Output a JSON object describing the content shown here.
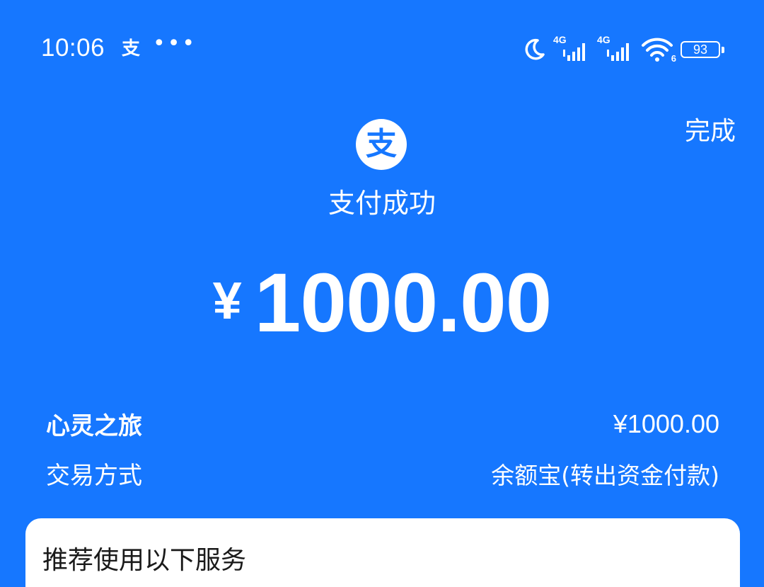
{
  "status_bar": {
    "time": "10:06",
    "app_icon_glyph": "支",
    "more_glyph": "•••",
    "net_label_1": "4G",
    "net_label_2": "4G",
    "wifi_sub": "6",
    "battery": "93",
    "icons": [
      "moon-icon",
      "signal-icon",
      "signal-icon",
      "wifi-icon",
      "battery-icon"
    ]
  },
  "header": {
    "done_label": "完成",
    "logo_glyph": "支",
    "title": "支付成功"
  },
  "payment": {
    "currency": "¥",
    "amount": "1000.00"
  },
  "details": {
    "merchant_label": "心灵之旅",
    "merchant_amount": "¥1000.00",
    "method_label": "交易方式",
    "method_value": "余额宝(转出资金付款)"
  },
  "card": {
    "title": "推荐使用以下服务"
  },
  "colors": {
    "background": "#1677ff",
    "text": "#ffffff",
    "card": "#ffffff",
    "card_text": "#1a1a1a"
  }
}
